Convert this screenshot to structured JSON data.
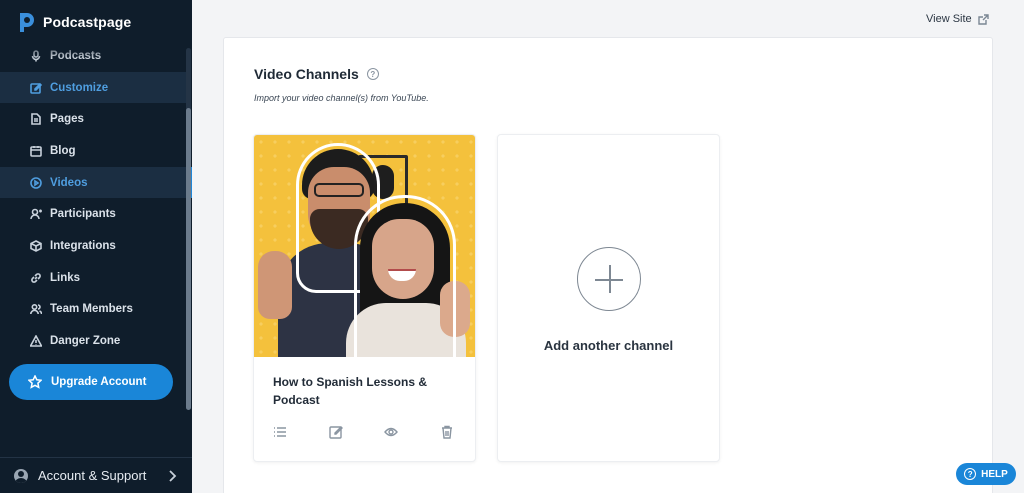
{
  "brand": {
    "name": "Podcastpage"
  },
  "sidebar": {
    "items": [
      {
        "label": "Podcasts",
        "icon": "microphone-icon"
      },
      {
        "label": "Customize",
        "icon": "pencil-square-icon"
      },
      {
        "label": "Pages",
        "icon": "document-icon"
      },
      {
        "label": "Blog",
        "icon": "calendar-icon"
      },
      {
        "label": "Videos",
        "icon": "play-circle-icon"
      },
      {
        "label": "Participants",
        "icon": "user-plus-icon"
      },
      {
        "label": "Integrations",
        "icon": "cube-icon"
      },
      {
        "label": "Links",
        "icon": "link-icon"
      },
      {
        "label": "Team Members",
        "icon": "users-icon"
      },
      {
        "label": "Danger Zone",
        "icon": "warning-icon"
      }
    ],
    "upgrade_label": "Upgrade Account",
    "account_label": "Account & Support"
  },
  "header": {
    "view_site": "View Site"
  },
  "main": {
    "title": "Video Channels",
    "subtitle": "Import your video channel(s) from YouTube.",
    "channels": [
      {
        "title": "How to Spanish Lessons & Podcast"
      }
    ],
    "add_label": "Add another channel"
  },
  "help": {
    "label": "HELP"
  },
  "colors": {
    "accent": "#1a86d8",
    "sidebar_bg": "#0f1d2b",
    "active_text": "#4f9ee0"
  }
}
